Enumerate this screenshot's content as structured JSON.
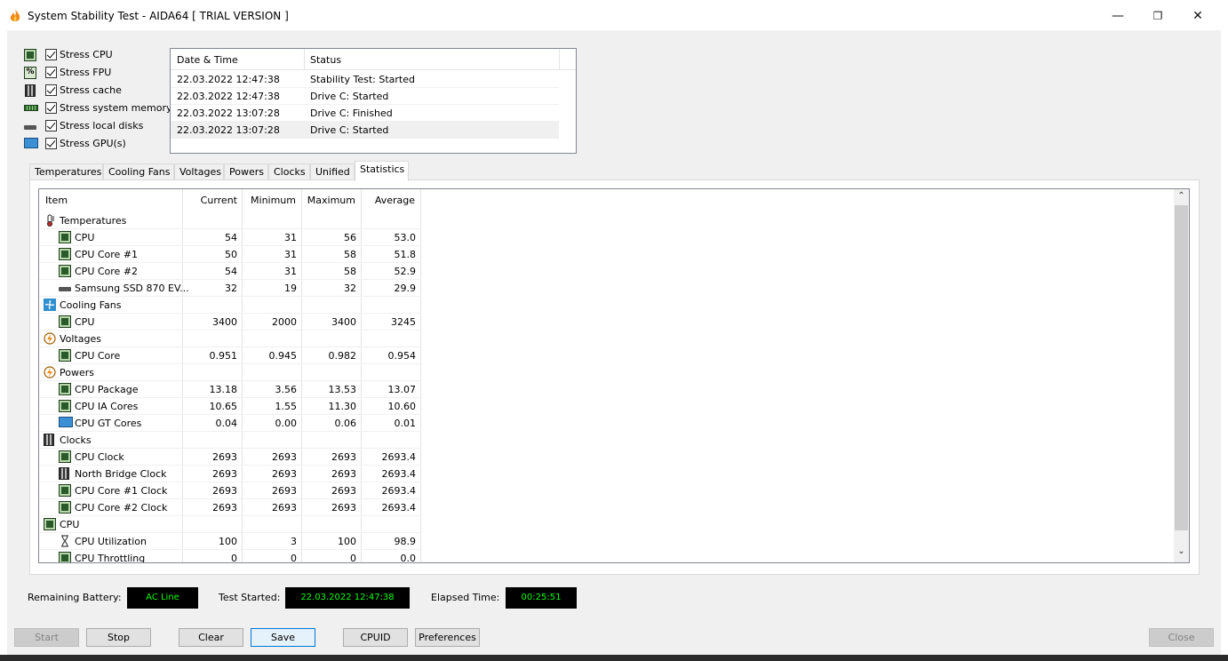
{
  "window": {
    "title": "System Stability Test - AIDA64  [ TRIAL VERSION ]",
    "minimize": "—",
    "restore": "❐",
    "close": "✕"
  },
  "options": [
    {
      "label": "Stress CPU",
      "checked": true,
      "icon": "cpu-icon"
    },
    {
      "label": "Stress FPU",
      "checked": true,
      "icon": "fpu-icon"
    },
    {
      "label": "Stress cache",
      "checked": true,
      "icon": "cache-icon"
    },
    {
      "label": "Stress system memory",
      "checked": true,
      "icon": "memory-icon"
    },
    {
      "label": "Stress local disks",
      "checked": true,
      "icon": "disk-icon"
    },
    {
      "label": "Stress GPU(s)",
      "checked": true,
      "icon": "gpu-icon"
    }
  ],
  "log": {
    "headers": {
      "datetime": "Date & Time",
      "status": "Status"
    },
    "rows": [
      {
        "datetime": "22.03.2022 12:47:38",
        "status": "Stability Test: Started"
      },
      {
        "datetime": "22.03.2022 12:47:38",
        "status": "Drive C: Started"
      },
      {
        "datetime": "22.03.2022 13:07:28",
        "status": "Drive C: Finished"
      },
      {
        "datetime": "22.03.2022 13:07:28",
        "status": "Drive C: Started"
      }
    ]
  },
  "tabs": [
    "Temperatures",
    "Cooling Fans",
    "Voltages",
    "Powers",
    "Clocks",
    "Unified",
    "Statistics"
  ],
  "active_tab": "Statistics",
  "stats": {
    "headers": {
      "item": "Item",
      "current": "Current",
      "minimum": "Minimum",
      "maximum": "Maximum",
      "average": "Average"
    },
    "rows": [
      {
        "kind": "group",
        "name": "Temperatures",
        "icon": "thermometer-icon"
      },
      {
        "kind": "item",
        "name": "CPU",
        "icon": "cpu-chip-icon",
        "current": "54",
        "minimum": "31",
        "maximum": "56",
        "average": "53.0"
      },
      {
        "kind": "item",
        "name": "CPU Core #1",
        "icon": "cpu-chip-icon",
        "current": "50",
        "minimum": "31",
        "maximum": "58",
        "average": "51.8"
      },
      {
        "kind": "item",
        "name": "CPU Core #2",
        "icon": "cpu-chip-icon",
        "current": "54",
        "minimum": "31",
        "maximum": "58",
        "average": "52.9"
      },
      {
        "kind": "item",
        "name": "Samsung SSD 870 EV...",
        "icon": "disk-icon",
        "current": "32",
        "minimum": "19",
        "maximum": "32",
        "average": "29.9"
      },
      {
        "kind": "group",
        "name": "Cooling Fans",
        "icon": "fan-icon"
      },
      {
        "kind": "item",
        "name": "CPU",
        "icon": "cpu-chip-icon",
        "current": "3400",
        "minimum": "2000",
        "maximum": "3400",
        "average": "3245"
      },
      {
        "kind": "group",
        "name": "Voltages",
        "icon": "voltage-icon"
      },
      {
        "kind": "item",
        "name": "CPU Core",
        "icon": "cpu-chip-icon",
        "current": "0.951",
        "minimum": "0.945",
        "maximum": "0.982",
        "average": "0.954"
      },
      {
        "kind": "group",
        "name": "Powers",
        "icon": "power-icon"
      },
      {
        "kind": "item",
        "name": "CPU Package",
        "icon": "cpu-chip-icon",
        "current": "13.18",
        "minimum": "3.56",
        "maximum": "13.53",
        "average": "13.07"
      },
      {
        "kind": "item",
        "name": "CPU IA Cores",
        "icon": "cpu-chip-icon",
        "current": "10.65",
        "minimum": "1.55",
        "maximum": "11.30",
        "average": "10.60"
      },
      {
        "kind": "item",
        "name": "CPU GT Cores",
        "icon": "gpu-icon",
        "current": "0.04",
        "minimum": "0.00",
        "maximum": "0.06",
        "average": "0.01"
      },
      {
        "kind": "group",
        "name": "Clocks",
        "icon": "clock-chip-icon"
      },
      {
        "kind": "item",
        "name": "CPU Clock",
        "icon": "cpu-chip-icon",
        "current": "2693",
        "minimum": "2693",
        "maximum": "2693",
        "average": "2693.4"
      },
      {
        "kind": "item",
        "name": "North Bridge Clock",
        "icon": "northbridge-icon",
        "current": "2693",
        "minimum": "2693",
        "maximum": "2693",
        "average": "2693.4"
      },
      {
        "kind": "item",
        "name": "CPU Core #1 Clock",
        "icon": "cpu-chip-icon",
        "current": "2693",
        "minimum": "2693",
        "maximum": "2693",
        "average": "2693.4"
      },
      {
        "kind": "item",
        "name": "CPU Core #2 Clock",
        "icon": "cpu-chip-icon",
        "current": "2693",
        "minimum": "2693",
        "maximum": "2693",
        "average": "2693.4"
      },
      {
        "kind": "group",
        "name": "CPU",
        "icon": "cpu-chip-icon"
      },
      {
        "kind": "item",
        "name": "CPU Utilization",
        "icon": "hourglass-icon",
        "current": "100",
        "minimum": "3",
        "maximum": "100",
        "average": "98.9"
      },
      {
        "kind": "item",
        "name": "CPU Throttling",
        "icon": "cpu-chip-icon",
        "current": "0",
        "minimum": "0",
        "maximum": "0",
        "average": "0.0"
      }
    ]
  },
  "status": {
    "battery_label": "Remaining Battery:",
    "battery_value": "AC Line",
    "started_label": "Test Started:",
    "started_value": "22.03.2022 12:47:38",
    "elapsed_label": "Elapsed Time:",
    "elapsed_value": "00:25:51"
  },
  "buttons": {
    "start": "Start",
    "stop": "Stop",
    "clear": "Clear",
    "save": "Save",
    "cpuid": "CPUID",
    "preferences": "Preferences",
    "close": "Close"
  },
  "colors": {
    "status_bg": "#000000",
    "status_fg": "#00ff00",
    "window_bg": "#f0f0f0"
  }
}
